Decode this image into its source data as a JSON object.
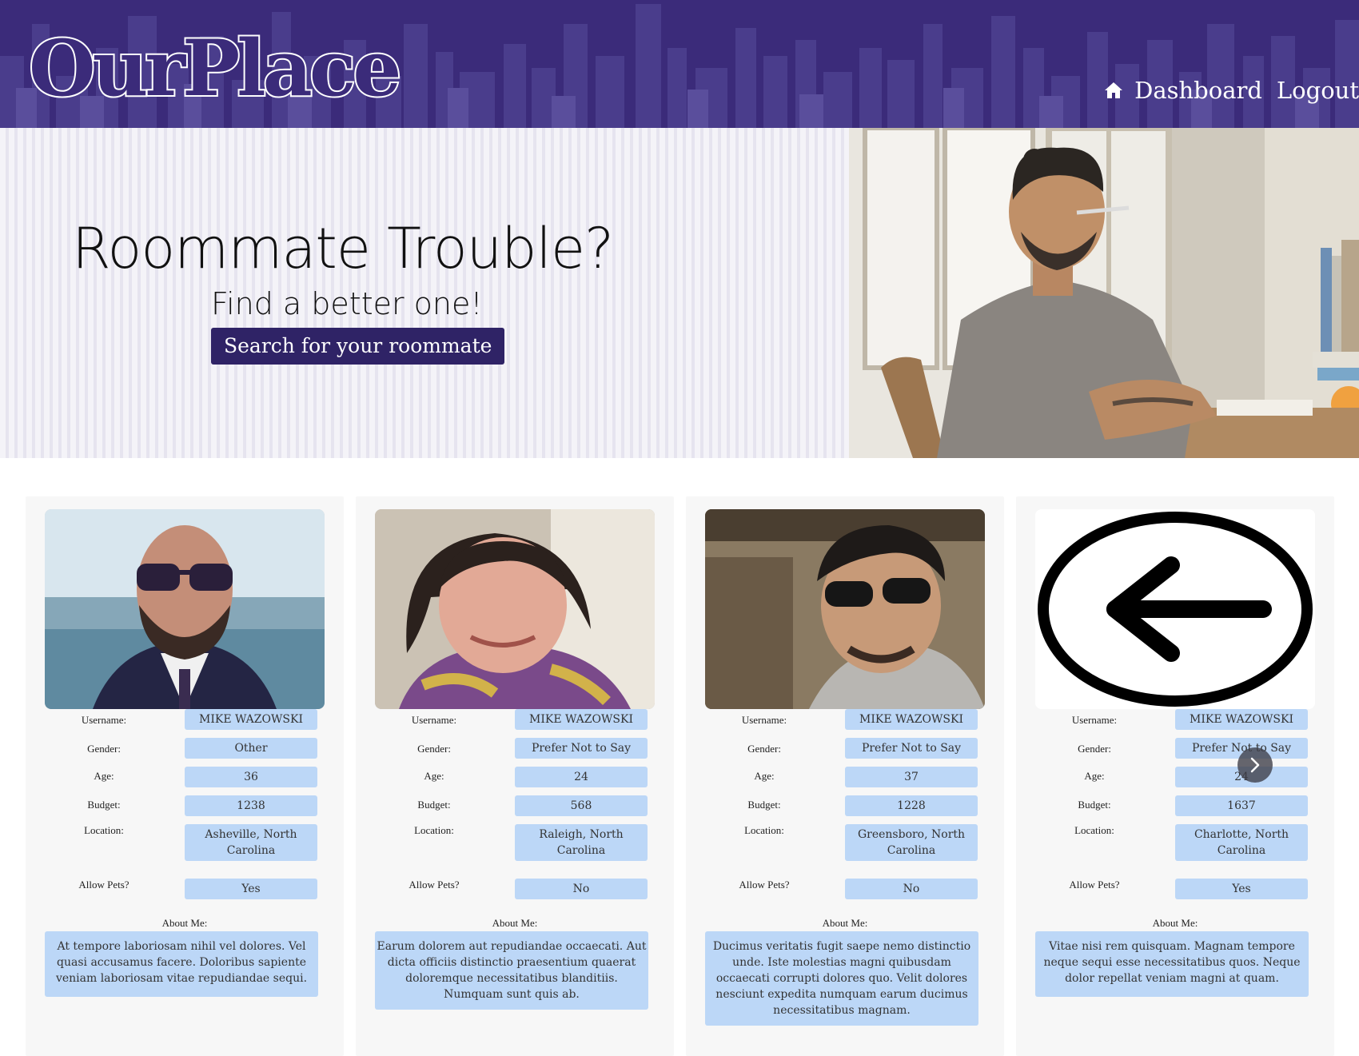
{
  "header": {
    "logo_text": "OurPlace",
    "nav": {
      "home_icon": "home-icon",
      "dashboard_label": "Dashboard",
      "logout_label": "Logout"
    },
    "background_color": "#3b2b7a"
  },
  "hero": {
    "title": "Roommate Trouble?",
    "subtitle": "Find a better one!",
    "search_button_label": "Search for your roommate",
    "accent_color": "#2f2366"
  },
  "labels": {
    "username": "Username:",
    "gender": "Gender:",
    "age": "Age:",
    "budget": "Budget:",
    "location": "Location:",
    "pets": "Allow Pets?",
    "about": "About Me:"
  },
  "profiles": [
    {
      "username": "MIKE WAZOWSKI",
      "gender": "Other",
      "age": "36",
      "budget": "1238",
      "location": "Asheville, North Carolina",
      "pets": "Yes",
      "about": "At tempore laboriosam nihil vel dolores. Vel quasi accusamus facere. Doloribus sapiente veniam laboriosam vitae repudiandae sequi."
    },
    {
      "username": "MIKE WAZOWSKI",
      "gender": "Prefer Not to Say",
      "age": "24",
      "budget": "568",
      "location": "Raleigh, North Carolina",
      "pets": "No",
      "about": "Earum dolorem aut repudiandae occaecati. Aut dicta officiis distinctio praesentium quaerat doloremque necessitatibus blanditiis. Numquam sunt quis ab."
    },
    {
      "username": "MIKE WAZOWSKI",
      "gender": "Prefer Not to Say",
      "age": "37",
      "budget": "1228",
      "location": "Greensboro, North Carolina",
      "pets": "No",
      "about": "Ducimus veritatis fugit saepe nemo distinctio unde. Iste molestias magni quibusdam occaecati corrupti dolores quo. Velit dolores nesciunt expedita numquam earum ducimus necessitatibus magnam."
    },
    {
      "username": "MIKE WAZOWSKI",
      "gender": "Prefer Not to Say",
      "age": "24",
      "budget": "1637",
      "location": "Charlotte, North Carolina",
      "pets": "Yes",
      "about": "Vitae nisi rem quisquam. Magnam tempore neque sequi esse necessitatibus quos. Neque dolor repellat veniam magni at quam."
    }
  ],
  "carousel": {
    "next_icon": "chevron-right-icon"
  },
  "field_color": "#bcd7f7"
}
